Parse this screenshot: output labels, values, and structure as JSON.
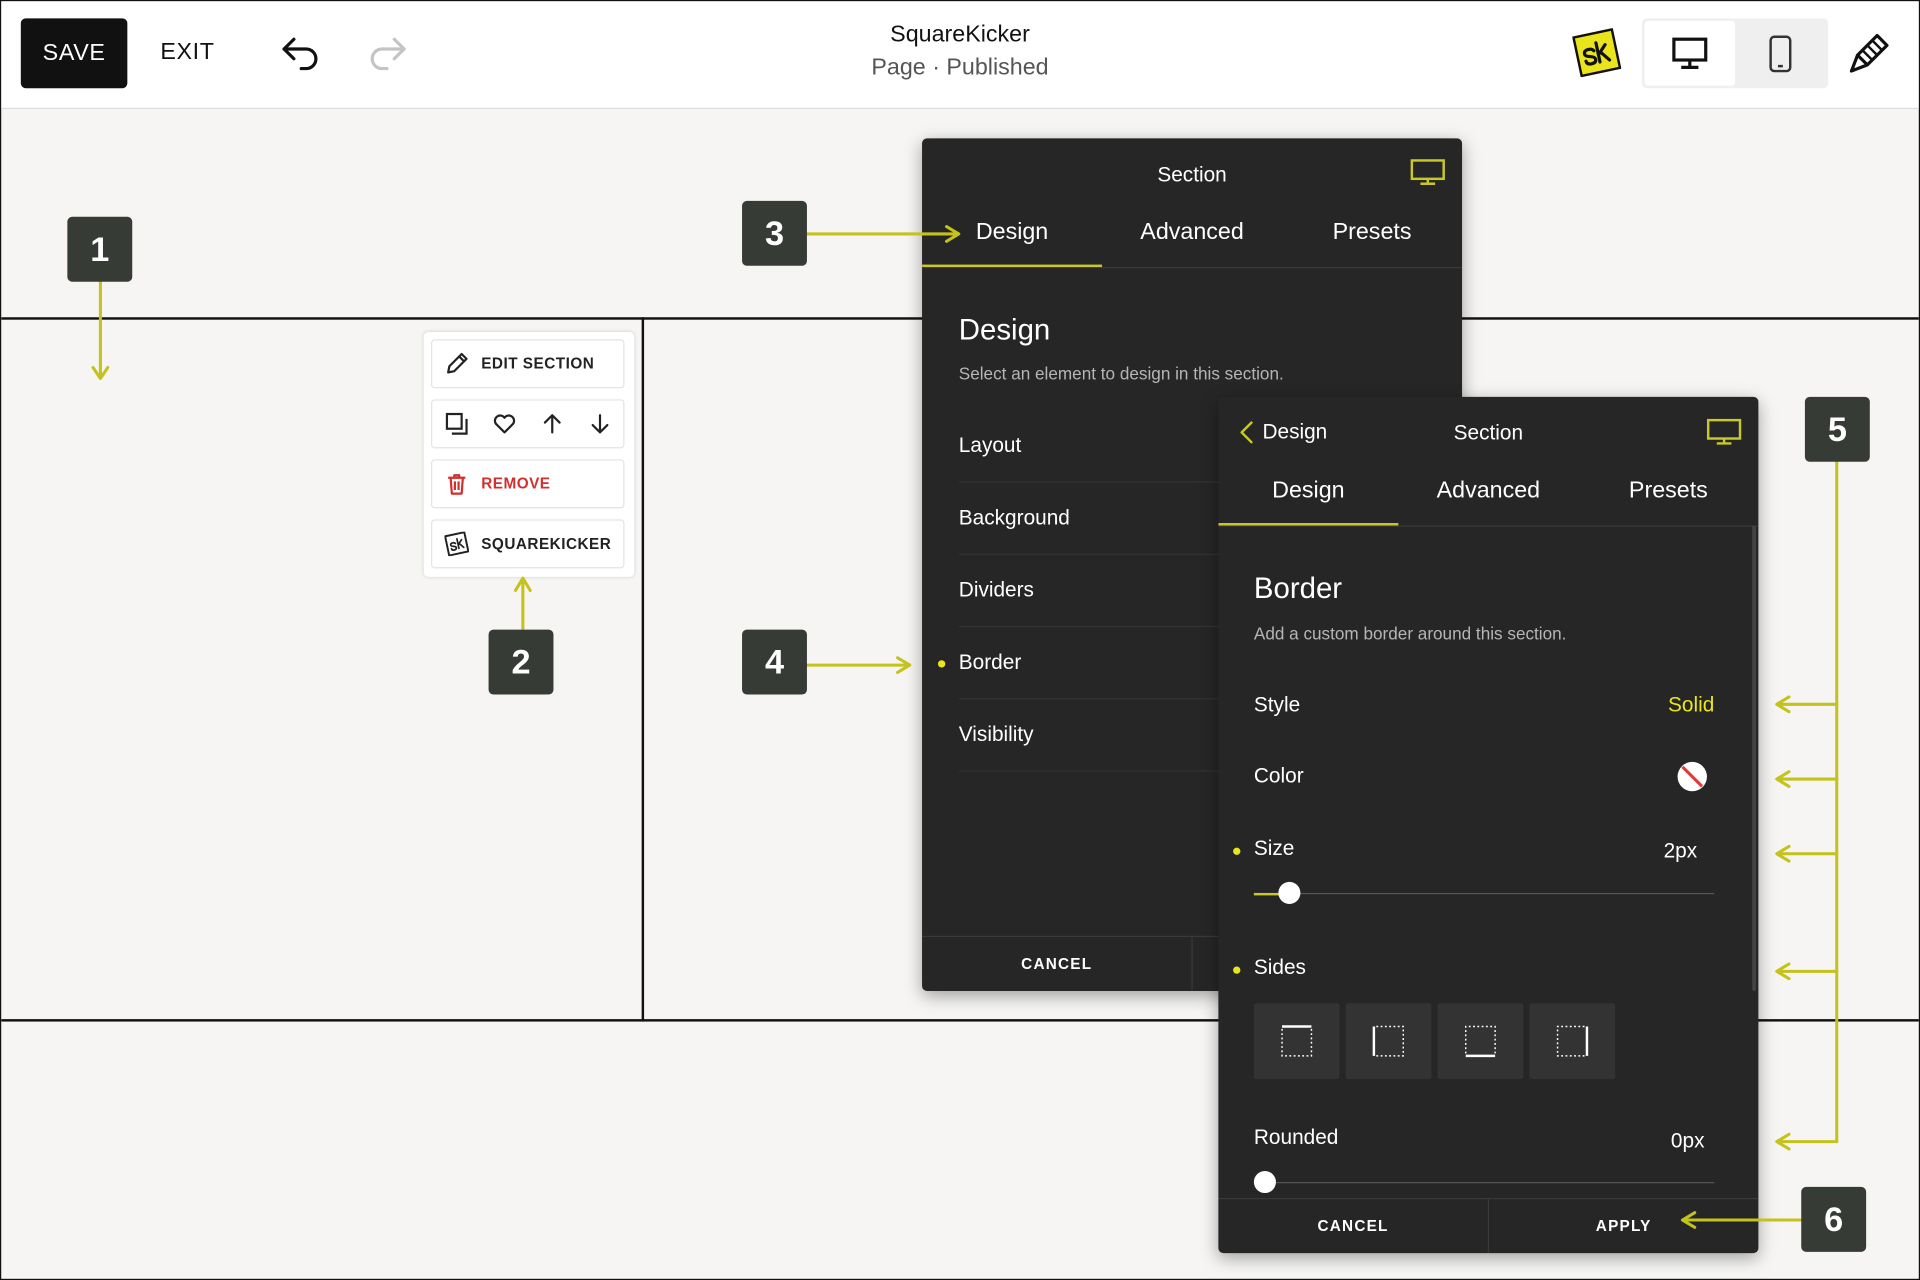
{
  "topbar": {
    "save_label": "SAVE",
    "exit_label": "EXIT",
    "site_title": "SquareKicker",
    "page_status": "Page · Published"
  },
  "callouts": [
    "1",
    "2",
    "3",
    "4",
    "5",
    "6"
  ],
  "context_menu": {
    "edit_section": "EDIT SECTION",
    "remove": "REMOVE",
    "squarekicker": "SQUAREKICKER"
  },
  "panel1": {
    "title": "Section",
    "tabs": [
      "Design",
      "Advanced",
      "Presets"
    ],
    "heading": "Design",
    "description": "Select an element to design in this section.",
    "items": [
      "Layout",
      "Background",
      "Dividers",
      "Border",
      "Visibility"
    ],
    "cancel": "CANCEL"
  },
  "panel2": {
    "back_label": "Design",
    "title": "Section",
    "tabs": [
      "Design",
      "Advanced",
      "Presets"
    ],
    "heading": "Border",
    "description": "Add a custom border around this section.",
    "style_label": "Style",
    "style_value": "Solid",
    "color_label": "Color",
    "size_label": "Size",
    "size_value": "2px",
    "size_fraction": 0.06,
    "sides_label": "Sides",
    "rounded_label": "Rounded",
    "rounded_value": "0px",
    "rounded_fraction": 0,
    "cancel": "CANCEL",
    "apply": "APPLY"
  },
  "colors": {
    "accent": "#c9c829",
    "panel_bg": "#262626",
    "callout_bg": "#363c35",
    "remove_red": "#d32f2f"
  }
}
